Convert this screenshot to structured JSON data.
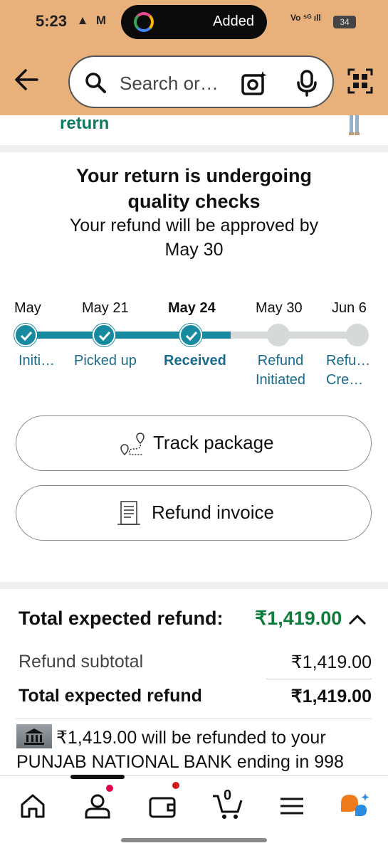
{
  "status_bar": {
    "time": "5:23",
    "pill_text": "Added",
    "battery": "34"
  },
  "header": {
    "search_placeholder": "Search or…"
  },
  "peek_title": "return",
  "return_status": {
    "title": "Your return is undergoing quality checks",
    "subtitle": "Your refund will be approved by May 30"
  },
  "timeline": {
    "progress": 0.62,
    "steps": [
      {
        "date": "May",
        "label": "Initi…",
        "state": "done",
        "current": false
      },
      {
        "date": "May 21",
        "label": "Picked up",
        "state": "done",
        "current": false
      },
      {
        "date": "May 24",
        "label": "Received",
        "state": "done",
        "current": true
      },
      {
        "date": "May 30",
        "label": "Refund Initiated",
        "state": "todo",
        "current": false
      },
      {
        "date": "Jun 6",
        "label": "Refu… Cre…",
        "state": "todo",
        "current": false
      }
    ]
  },
  "actions": {
    "track_label": "Track package",
    "invoice_label": "Refund invoice"
  },
  "refund": {
    "total_label": "Total expected refund:",
    "total_amount": "₹1,419.00",
    "subtotal_label": "Refund subtotal",
    "subtotal_amount": "₹1,419.00",
    "expected_label": "Total expected refund",
    "expected_amount": "₹1,419.00",
    "bank_message": "₹1,419.00 will be refunded to your PUNJAB NATIONAL BANK ending in 998"
  },
  "bottom_nav": {
    "cart_count": "0"
  },
  "colors": {
    "accent": "#178aa0",
    "refund_green": "#0e7c3a",
    "header_bg": "#e8b07a"
  }
}
